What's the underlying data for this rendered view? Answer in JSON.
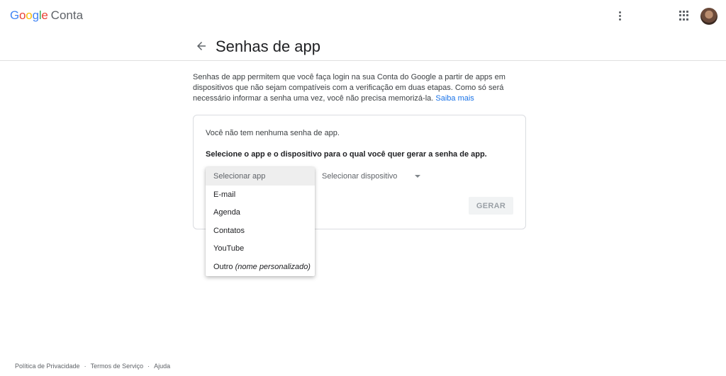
{
  "topbar": {
    "logo_word": "Google",
    "product": "Conta",
    "brand_colors": [
      "#4285F4",
      "#EA4335",
      "#FBBC05",
      "#4285F4",
      "#34A853",
      "#EA4335"
    ],
    "icons": [
      "more-vert-icon",
      "apps-grid-icon",
      "avatar"
    ]
  },
  "header": {
    "back_icon": "arrow-back-icon",
    "title": "Senhas de app"
  },
  "description": {
    "text": "Senhas de app permitem que você faça login na sua Conta do Google a partir de apps em dispositivos que não sejam compatíveis com a verificação em duas etapas. Como só será necessário informar a senha uma vez, você não precisa memorizá-la.",
    "link": "Saiba mais"
  },
  "card": {
    "no_passwords": "Você não tem nenhuma senha de app.",
    "instruction": "Selecione o app e o dispositivo para o qual você quer gerar a senha de app.",
    "device_select": "Selecionar dispositivo",
    "generate_button": "GERAR"
  },
  "app_dropdown": {
    "selected": "Selecionar app",
    "options": [
      {
        "label": "E-mail"
      },
      {
        "label": "Agenda"
      },
      {
        "label": "Contatos"
      },
      {
        "label": "YouTube"
      },
      {
        "label": "Outro",
        "hint": "(nome personalizado)"
      }
    ]
  },
  "footer": {
    "privacy": "Política de Privacidade",
    "terms": "Termos de Serviço",
    "help": "Ajuda",
    "separator": "·"
  },
  "colors": {
    "link": "#1a73e8",
    "border": "#dadce0",
    "selected_bg": "#eeeeee"
  }
}
